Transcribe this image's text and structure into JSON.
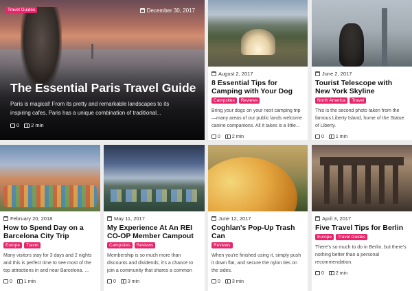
{
  "hero": {
    "category": "Travel Guides",
    "date": "December 30, 2017",
    "title": "The Essential Paris Travel Guide",
    "excerpt": "Paris is magical! From its pretty and remarkable landscapes to its inspiring cafes, Paris has a unique combination of traditional...",
    "comments": "0",
    "read_time": "2 min"
  },
  "posts": [
    {
      "date": "August 2, 2017",
      "title": "8 Essential Tips for Camping with Your Dog",
      "tags": [
        "Campsites",
        "Reviews"
      ],
      "excerpt": "Bring your dogs on your next camping trip—many areas of our public lands welcome canine companions. All it takes is a little...",
      "comments": "0",
      "read_time": "2 min"
    },
    {
      "date": "June 2, 2017",
      "title": "Tourist Telescope with New York Skyline",
      "tags": [
        "North America",
        "Travel"
      ],
      "excerpt": "This is the second photo taken from the famous Liberty Island, home of the Statue of Liberty.",
      "comments": "0",
      "read_time": "1 min"
    },
    {
      "date": "February 20, 2018",
      "title": "How to Spend Day on a Barcelona City Trip",
      "tags": [
        "Europe",
        "Travel"
      ],
      "excerpt": "Many visitors stay for 3 days and 2 nights and this is perfect time to see most of the top attractions in and near Barcelona. ...",
      "comments": "0",
      "read_time": "1 min"
    },
    {
      "date": "May 11, 2017",
      "title": "My Experience At An REI CO-OP Member Campout",
      "tags": [
        "Campsites",
        "Reviews"
      ],
      "excerpt": "Membership is so much more than discounts and dividends; it's a chance to join a community that shares a common love for th...",
      "comments": "0",
      "read_time": "3 min"
    },
    {
      "date": "June 12, 2017",
      "title": "Coghlan's Pop-Up Trash Can",
      "tags": [
        "Reviews"
      ],
      "excerpt": "When you're finished using it, simply push it down flat, and secure the nylon ties on the sides.",
      "comments": "0",
      "read_time": "3 min"
    },
    {
      "date": "April 3, 2017",
      "title": "Five Travel Tips for Berlin",
      "tags": [
        "Europe",
        "Travel Guides"
      ],
      "excerpt": "There's so much to do in Berlin, but there's nothing better than a personal recommendation.",
      "comments": "0",
      "read_time": "2 min"
    }
  ],
  "icons": {
    "date": "calendar-icon",
    "comments": "comment-icon",
    "read_time": "book-icon"
  },
  "colors": {
    "tag": "#e8246a"
  }
}
